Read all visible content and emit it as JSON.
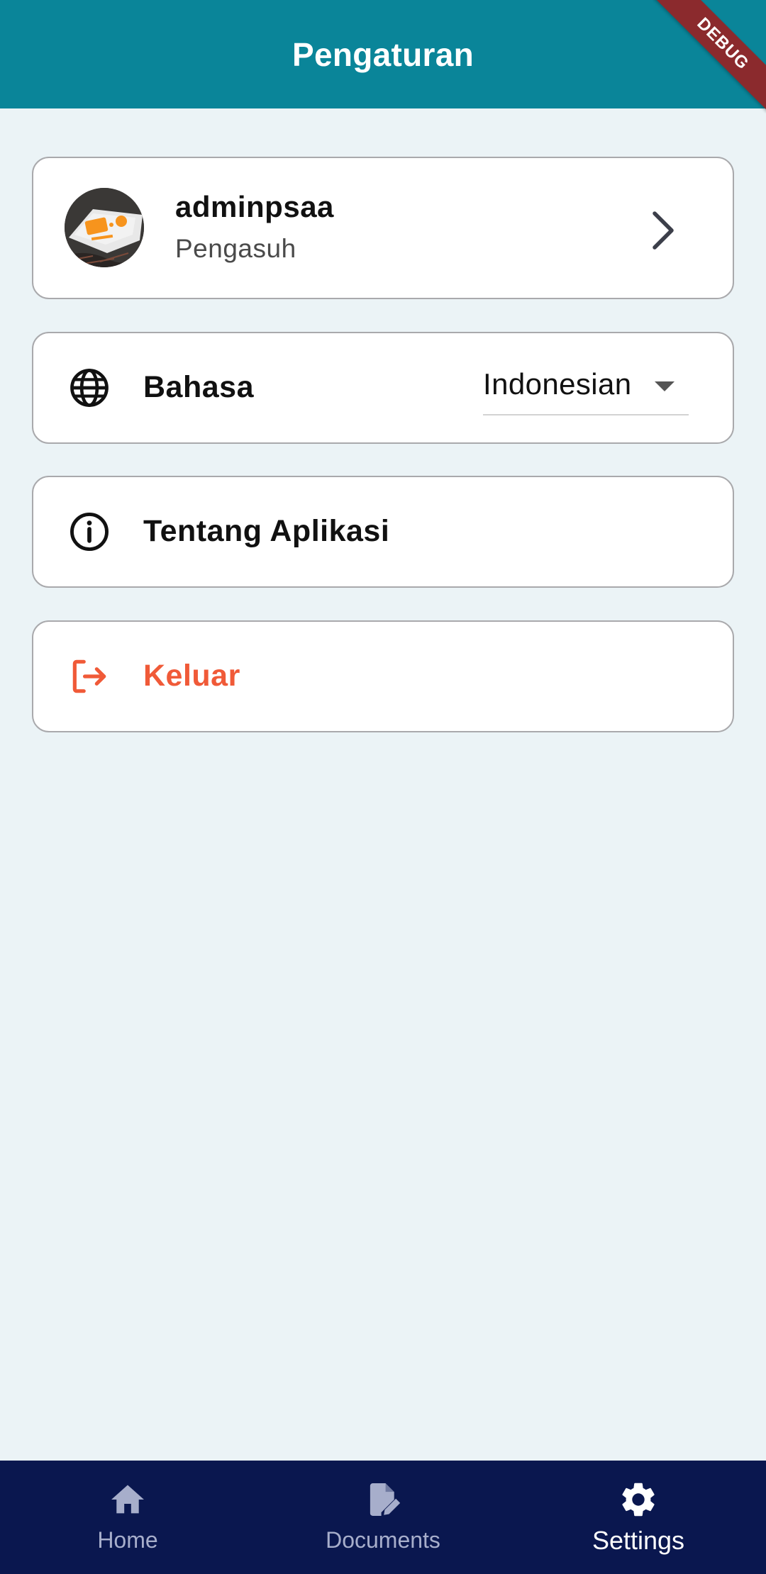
{
  "appbar": {
    "title": "Pengaturan",
    "background": "#0A8599"
  },
  "debug_banner": {
    "label": "DEBUG",
    "color": "#8B2A2D"
  },
  "profile": {
    "name": "adminpsaa",
    "role": "Pengasuh",
    "avatar_icon": "avatar-image",
    "chevron_icon": "chevron-right-icon"
  },
  "language": {
    "icon": "globe-icon",
    "label": "Bahasa",
    "selected": "Indonesian",
    "caret_icon": "dropdown-caret-icon"
  },
  "about": {
    "icon": "info-icon",
    "label": "Tentang Aplikasi"
  },
  "logout": {
    "icon": "logout-icon",
    "label": "Keluar",
    "color": "#F05A38"
  },
  "bottom_nav": {
    "background": "#0A174F",
    "items": [
      {
        "label": "Home",
        "icon": "home-icon",
        "active": false
      },
      {
        "label": "Documents",
        "icon": "document-edit-icon",
        "active": false
      },
      {
        "label": "Settings",
        "icon": "gear-icon",
        "active": true
      }
    ]
  }
}
